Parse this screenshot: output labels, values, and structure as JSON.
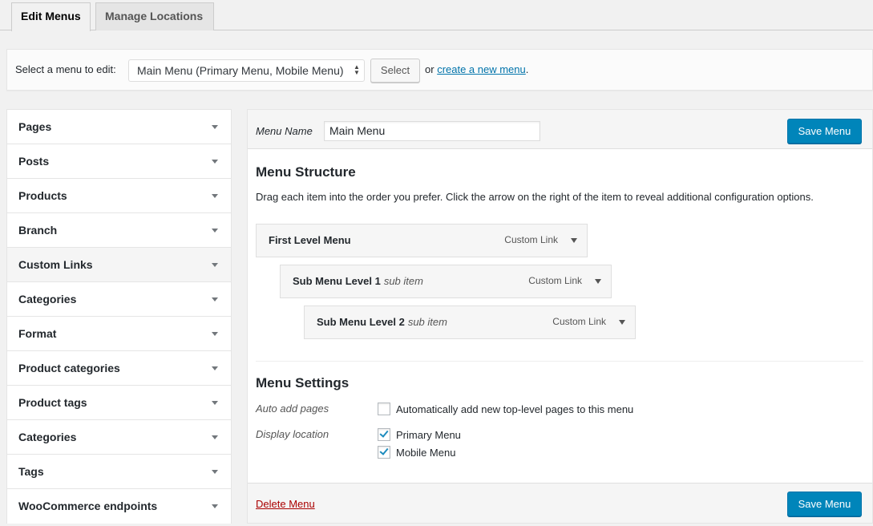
{
  "tabs": [
    {
      "label": "Edit Menus"
    },
    {
      "label": "Manage Locations"
    }
  ],
  "select_bar": {
    "label": "Select a menu to edit:",
    "selected": "Main Menu (Primary Menu, Mobile Menu)",
    "select_button": "Select",
    "or_text": "or",
    "create_link": "create a new menu",
    "period": "."
  },
  "accordion": {
    "items": [
      {
        "label": "Pages"
      },
      {
        "label": "Posts"
      },
      {
        "label": "Products"
      },
      {
        "label": "Branch"
      },
      {
        "label": "Custom Links"
      },
      {
        "label": "Categories"
      },
      {
        "label": "Format"
      },
      {
        "label": "Product categories"
      },
      {
        "label": "Product tags"
      },
      {
        "label": "Categories"
      },
      {
        "label": "Tags"
      },
      {
        "label": "WooCommerce endpoints"
      }
    ]
  },
  "editor": {
    "menu_name_label": "Menu Name",
    "menu_name_value": "Main Menu",
    "save_label": "Save Menu",
    "structure_heading": "Menu Structure",
    "structure_desc": "Drag each item into the order you prefer. Click the arrow on the right of the item to reveal additional configuration options.",
    "items": [
      {
        "title": "First Level Menu",
        "sub": "",
        "type": "Custom Link"
      },
      {
        "title": "Sub Menu Level 1",
        "sub": "sub item",
        "type": "Custom Link"
      },
      {
        "title": "Sub Menu Level 2",
        "sub": "sub item",
        "type": "Custom Link"
      }
    ],
    "settings_heading": "Menu Settings",
    "auto_add_label": "Auto add pages",
    "auto_add_text": "Automatically add new top-level pages to this menu",
    "auto_add_checked": false,
    "display_location_label": "Display location",
    "locations": [
      {
        "label": "Primary Menu",
        "checked": true
      },
      {
        "label": "Mobile Menu",
        "checked": true
      }
    ],
    "delete_label": "Delete Menu"
  },
  "colors": {
    "primary_button": "#0085ba",
    "link": "#0073aa",
    "delete_link": "#aa0000",
    "checkmark": "#1e8cbe"
  }
}
